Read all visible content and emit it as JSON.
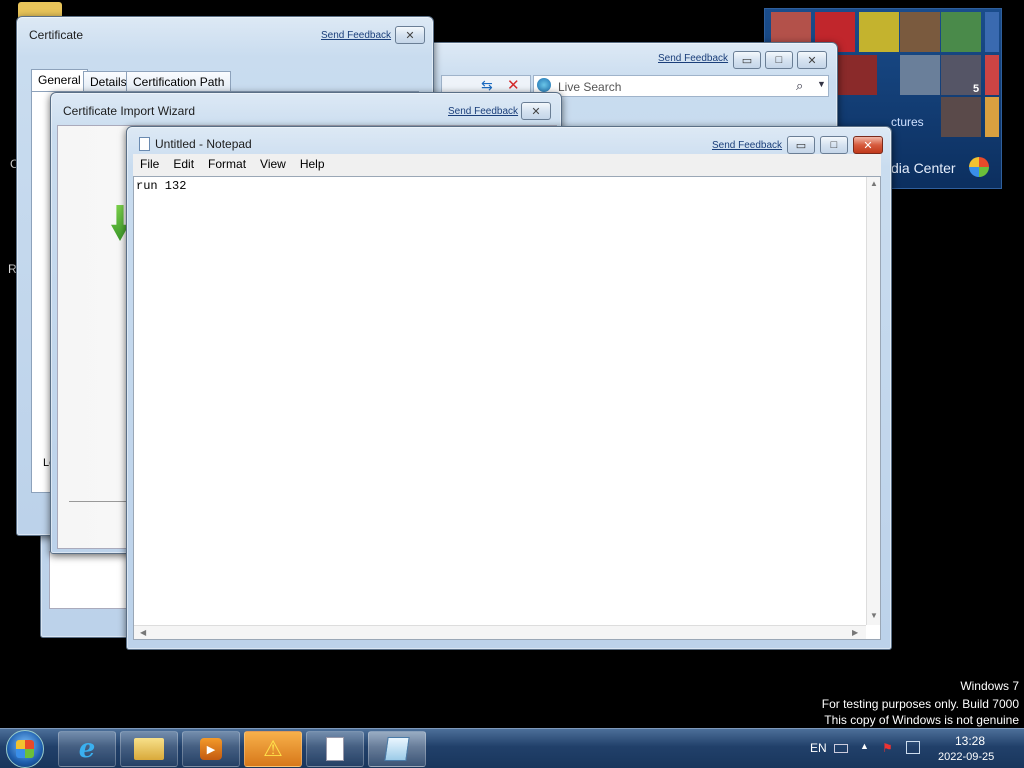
{
  "desktop": {
    "watermark_line1": "Windows 7",
    "watermark_line2": "For testing purposes only. Build 7000",
    "watermark_line3": "This copy of Windows is not genuine",
    "edge_chars": [
      "C",
      "R"
    ]
  },
  "certificate_dialog": {
    "title": "Certificate",
    "feedback": "Send Feedback",
    "tabs": [
      "General",
      "Details",
      "Certification Path"
    ],
    "partial_label": "Le"
  },
  "ie_window": {
    "feedback": "Send Feedback",
    "search_placeholder": "Live Search"
  },
  "import_wizard": {
    "title": "Certificate Import Wizard",
    "feedback": "Send Feedback"
  },
  "media_center": {
    "label_partial": "ctures",
    "label": "dia Center",
    "badge": "5"
  },
  "notepad": {
    "title": "Untitled - Notepad",
    "feedback": "Send Feedback",
    "menu": [
      "File",
      "Edit",
      "Format",
      "View",
      "Help"
    ],
    "content": "run 132"
  },
  "taskbar": {
    "language": "EN",
    "time": "13:28",
    "date": "2022-09-25",
    "items": [
      "start-orb",
      "internet-explorer",
      "windows-explorer",
      "media-player",
      "warning",
      "blank-document",
      "notepad"
    ]
  },
  "colors": {
    "accent": "#2a5da8",
    "close_red": "#c0391b",
    "taskbar": "#21406a"
  }
}
